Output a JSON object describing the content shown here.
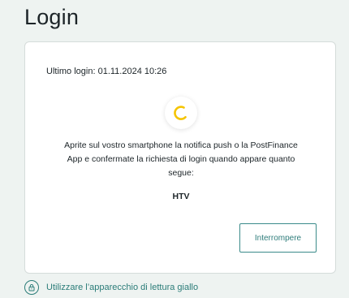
{
  "page": {
    "title": "Login"
  },
  "card": {
    "last_login": "Ultimo login: 01.11.2024 10:26",
    "instructions": "Aprite sul vostro smartphone la notifica push o la PostFinance App e confermate la richiesta di login quando appare quanto segue:",
    "code": "HTV",
    "cancel_label": "Interrompere"
  },
  "footer": {
    "reader_link_label": "Utilizzare l’apparecchio di lettura giallo",
    "reader_icon": "lock-icon"
  },
  "colors": {
    "accent": "#2a7c78",
    "spinner": "#f5c400",
    "background": "#eef3f1"
  }
}
